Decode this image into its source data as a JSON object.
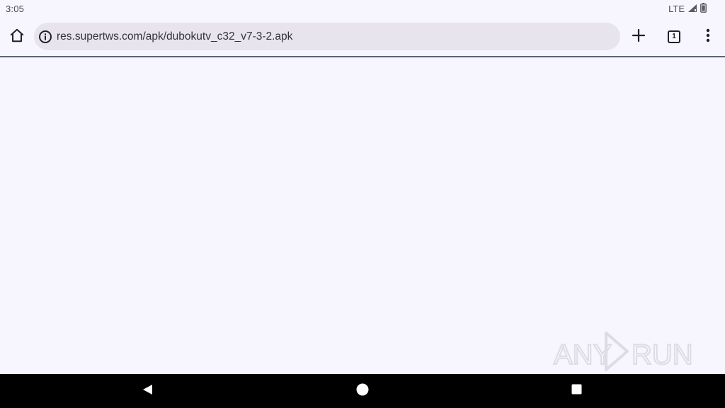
{
  "status_bar": {
    "time": "3:05",
    "network": "LTE"
  },
  "toolbar": {
    "url": "res.supertws.com/apk/dubokutv_c32_v7-3-2.apk",
    "tab_count": "1"
  },
  "watermark": {
    "text": "ANY RUN"
  },
  "icons": {
    "home": "home-icon",
    "info": "info-icon",
    "new_tab": "plus-icon",
    "tabs": "tab-switcher-icon",
    "menu": "more-vert-icon",
    "signal": "signal-icon",
    "battery": "battery-icon",
    "nav_back": "back-triangle-icon",
    "nav_home": "home-circle-icon",
    "nav_recents": "recents-square-icon"
  }
}
